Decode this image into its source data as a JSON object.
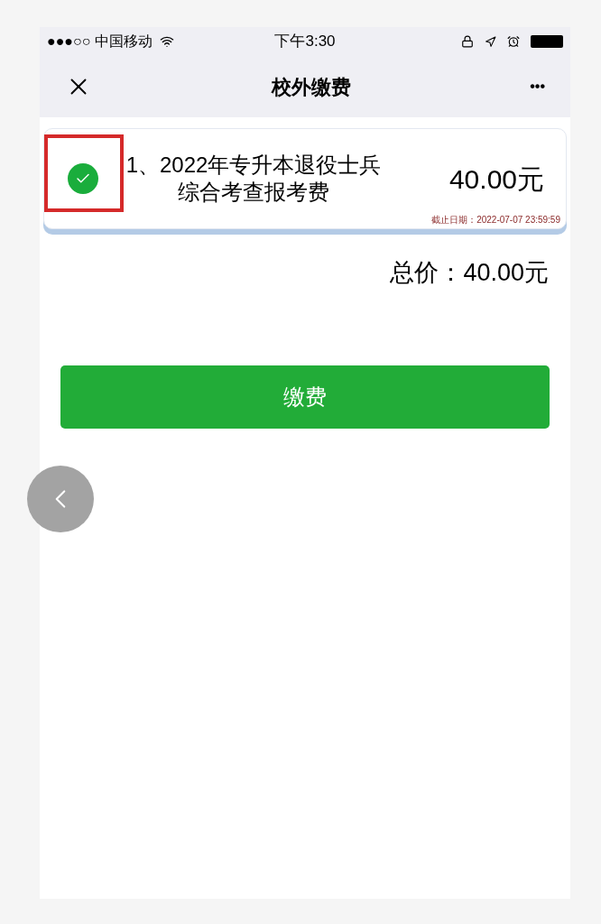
{
  "status_bar": {
    "carrier": "●●●○○ 中国移动",
    "time": "下午3:30"
  },
  "nav": {
    "title": "校外缴费",
    "more": "•••"
  },
  "items": [
    {
      "checked": true,
      "title": "1、2022年专升本退役士兵综合考查报考费",
      "price": "40.00元",
      "deadline": "截止日期：2022-07-07 23:59:59"
    }
  ],
  "total": "总价：40.00元",
  "pay_button": "缴费"
}
